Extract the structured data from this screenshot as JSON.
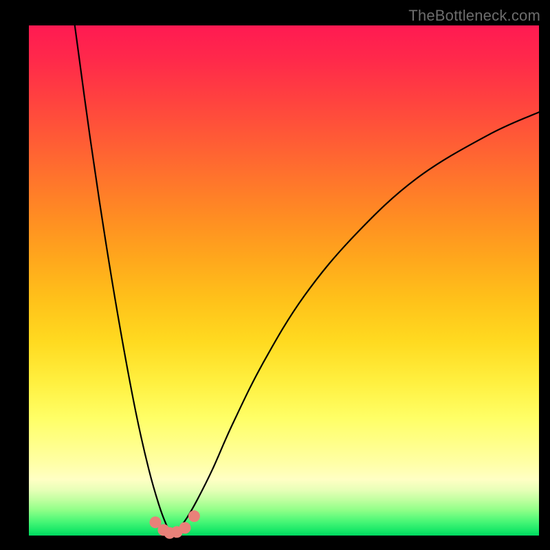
{
  "watermark": "TheBottleneck.com",
  "colors": {
    "frame": "#000000",
    "curve": "#000000",
    "marker_fill": "#e98179",
    "marker_stroke": "#d66b63"
  },
  "chart_data": {
    "type": "line",
    "title": "",
    "xlabel": "",
    "ylabel": "",
    "xlim": [
      0,
      100
    ],
    "ylim": [
      0,
      100
    ],
    "note": "Axes are unlabeled; values are pixel-fraction estimates (0–100) of the plotting area. Two curve branches descend to a minimum near x≈28 (y≈0) forming a V/cusp shape. Markers cluster near the minimum.",
    "series": [
      {
        "name": "left-branch",
        "x": [
          9.0,
          12.0,
          15.0,
          18.0,
          21.0,
          23.5,
          25.5,
          27.0,
          27.8,
          28.3
        ],
        "y": [
          100.0,
          78.0,
          58.0,
          40.0,
          24.0,
          13.0,
          6.0,
          2.0,
          0.8,
          0.3
        ]
      },
      {
        "name": "right-branch",
        "x": [
          28.3,
          29.5,
          31.0,
          33.0,
          36.0,
          40.0,
          46.0,
          54.0,
          64.0,
          76.0,
          90.0,
          100.0
        ],
        "y": [
          0.3,
          1.5,
          3.5,
          7.0,
          13.0,
          22.0,
          34.0,
          47.0,
          59.0,
          70.0,
          78.5,
          83.0
        ]
      }
    ],
    "markers": {
      "name": "highlight-points",
      "x": [
        24.8,
        26.4,
        27.6,
        29.0,
        30.6,
        32.4
      ],
      "y": [
        2.6,
        1.1,
        0.5,
        0.7,
        1.5,
        3.8
      ]
    }
  }
}
